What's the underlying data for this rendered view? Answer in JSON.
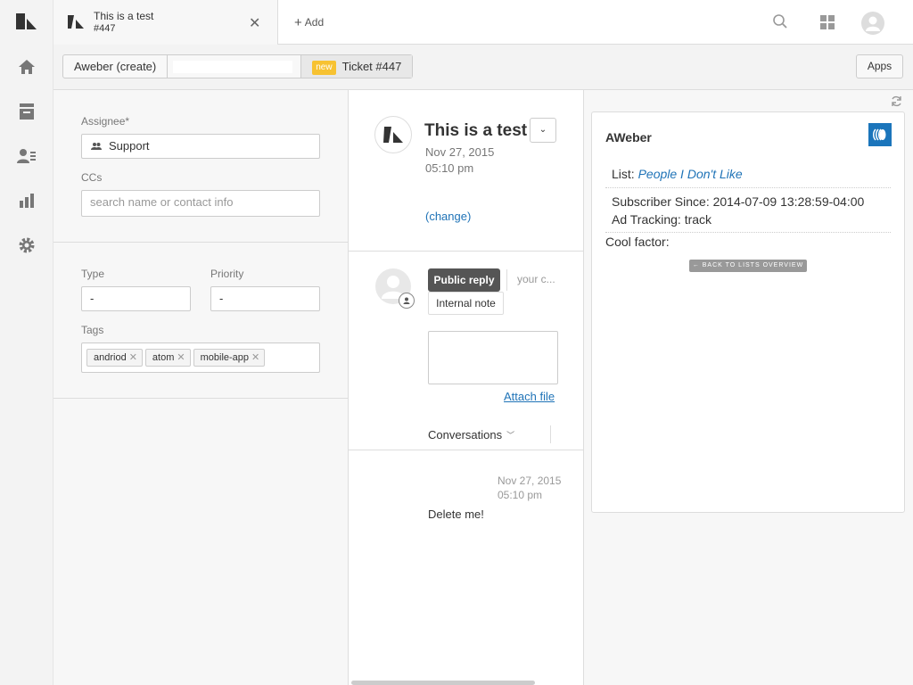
{
  "nav": {
    "icons": [
      "zendesk-logo-icon",
      "home-icon",
      "views-icon",
      "customers-icon",
      "reporting-icon",
      "admin-gear-icon"
    ]
  },
  "topbar": {
    "tab_title": "This is a test",
    "tab_subtitle": "#447",
    "add_label": "Add"
  },
  "breadcrumb": {
    "org": "Aweber (create)",
    "badge": "new",
    "ticket": "Ticket #447",
    "apps_label": "Apps"
  },
  "props": {
    "assignee_label": "Assignee*",
    "assignee_value": "Support",
    "ccs_label": "CCs",
    "ccs_placeholder": "search name or contact info",
    "type_label": "Type",
    "type_value": "-",
    "priority_label": "Priority",
    "priority_value": "-",
    "tags_label": "Tags",
    "tags": [
      "andriod",
      "atom",
      "mobile-app"
    ]
  },
  "conversation": {
    "subject": "This is a test",
    "date": "Nov 27, 2015",
    "time": "05:10 pm",
    "change_label": "(change)",
    "public_reply": "Public reply",
    "your_comment": "your c...",
    "internal_note": "Internal note",
    "attach_file": "Attach file",
    "conversations_label": "Conversations",
    "comment_date": "Nov 27, 2015",
    "comment_time": "05:10 pm",
    "comment_text": "Delete me!"
  },
  "app": {
    "title": "AWeber",
    "list_label": "List:",
    "list_value": "People I Don't Like",
    "subscriber_label": "Subscriber Since:",
    "subscriber_value": "2014-07-09 13:28:59-04:00",
    "ad_label": "Ad Tracking:",
    "ad_value": "track",
    "cool_label": "Cool factor:",
    "back_button": "← BACK TO LISTS OVERVIEW"
  }
}
